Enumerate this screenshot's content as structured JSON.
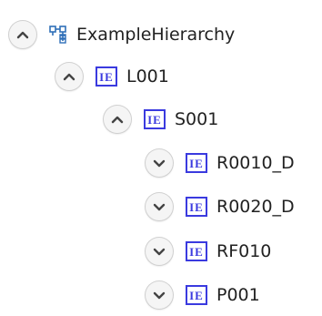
{
  "tree": {
    "root": {
      "label": "ExampleHierarchy",
      "expanded": true,
      "icon": "hierarchy-icon",
      "children": [
        {
          "label": "L001",
          "expanded": true,
          "icon": "ie-entity-icon",
          "children": [
            {
              "label": "S001",
              "expanded": true,
              "icon": "ie-entity-icon",
              "children": [
                {
                  "label": "R0010_D",
                  "expanded": false,
                  "icon": "ie-entity-icon"
                },
                {
                  "label": "R0020_D",
                  "expanded": false,
                  "icon": "ie-entity-icon"
                },
                {
                  "label": "RF010",
                  "expanded": false,
                  "icon": "ie-entity-icon"
                },
                {
                  "label": "P001",
                  "expanded": false,
                  "icon": "ie-entity-icon"
                }
              ]
            }
          ]
        }
      ]
    },
    "ie_icon_text": "IE",
    "colors": {
      "icon_blue": "#3a3adf",
      "hierarchy_icon": "#2f6fb8",
      "toggle_bg": "#f5f5f5",
      "toggle_chevron": "#444444",
      "text": "#222222"
    }
  }
}
